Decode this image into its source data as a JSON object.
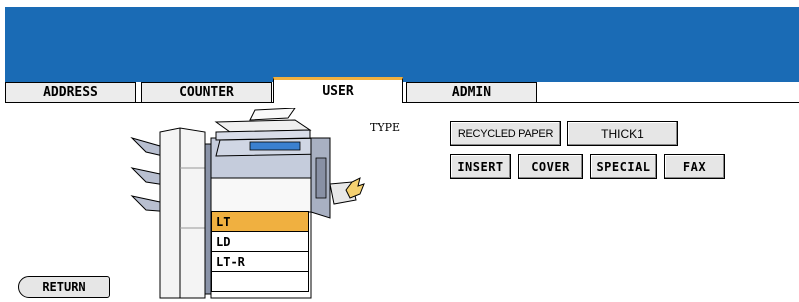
{
  "tabs": [
    {
      "label": "ADDRESS",
      "active": false
    },
    {
      "label": "COUNTER",
      "active": false
    },
    {
      "label": "USER",
      "active": true
    },
    {
      "label": "ADMIN",
      "active": false
    }
  ],
  "type_label": "TYPE",
  "paper_types": {
    "recycled": "RECYCLED PAPER",
    "thick1": "THICK1",
    "insert": "INSERT",
    "cover": "COVER",
    "special": "SPECIAL",
    "fax": "FAX"
  },
  "drawers": [
    {
      "label": "LT",
      "selected": true
    },
    {
      "label": "LD",
      "selected": false
    },
    {
      "label": "LT-R",
      "selected": false
    },
    {
      "label": "",
      "selected": false
    }
  ],
  "return_label": "RETURN",
  "colors": {
    "header": "#1a6bb5",
    "tab_active_accent": "#f0b040",
    "drawer_selected": "#f0b040",
    "button_face": "#e6e6e6"
  }
}
